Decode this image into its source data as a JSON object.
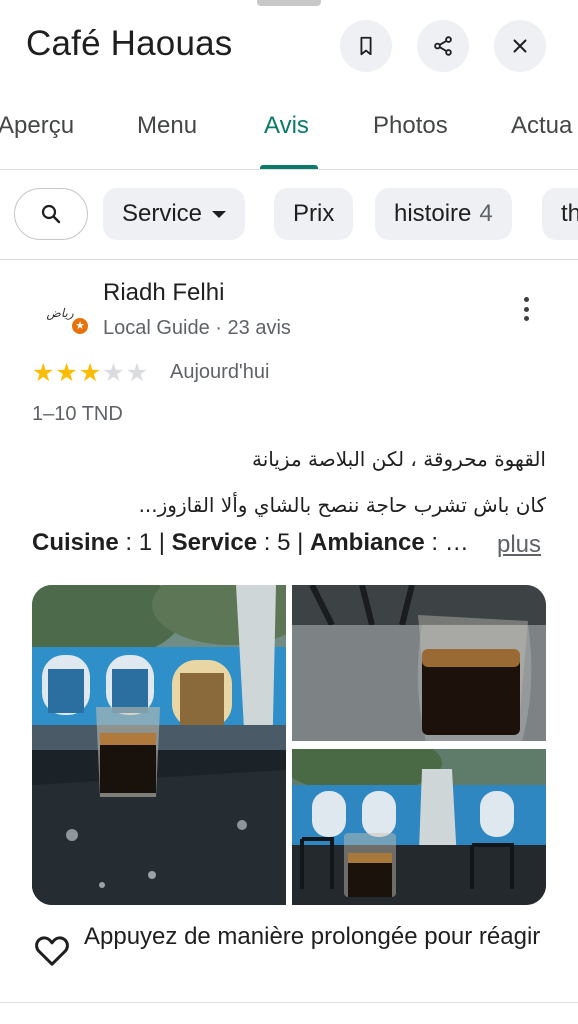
{
  "header": {
    "title": "Café Haouas",
    "icons": [
      "bookmark-icon",
      "share-icon",
      "close-icon"
    ]
  },
  "tabs": [
    {
      "label": "Aperçu",
      "active": false
    },
    {
      "label": "Menu",
      "active": false
    },
    {
      "label": "Avis",
      "active": true
    },
    {
      "label": "Photos",
      "active": false
    },
    {
      "label": "Actua",
      "active": false
    }
  ],
  "chips": {
    "search_icon": "search-icon",
    "items": [
      {
        "label": "Service",
        "count": "",
        "dropdown": true
      },
      {
        "label": "Prix",
        "count": ""
      },
      {
        "label": "histoire",
        "count": "4"
      },
      {
        "label": "th",
        "count": ""
      }
    ]
  },
  "review": {
    "author": "Riadh Felhi",
    "avatar_signature": "رياض",
    "meta": "Local Guide · 23 avis",
    "rating": 3,
    "max_rating": 5,
    "date": "Aujourd'hui",
    "price": "1–10 TND",
    "text_lines": [
      "القهوة محروقة ، لكن البلاصة مزيانة",
      "كان باش تشرب حاجة ننصح بالشاي وألا القازوز..."
    ],
    "attributes": {
      "cuisine_label": "Cuisine",
      "cuisine_value": "1",
      "service_label": "Service",
      "service_value": "5",
      "ambiance_label": "Ambiance",
      "ellipsis": "…"
    },
    "more_link": "plus",
    "react_text": "Appuyez de manière prolongée pour réagir"
  },
  "colors": {
    "accent": "#0b7a6b",
    "star": "#fbbc04",
    "chip_bg": "#eef0f3",
    "local_guide": "#e8710a"
  }
}
